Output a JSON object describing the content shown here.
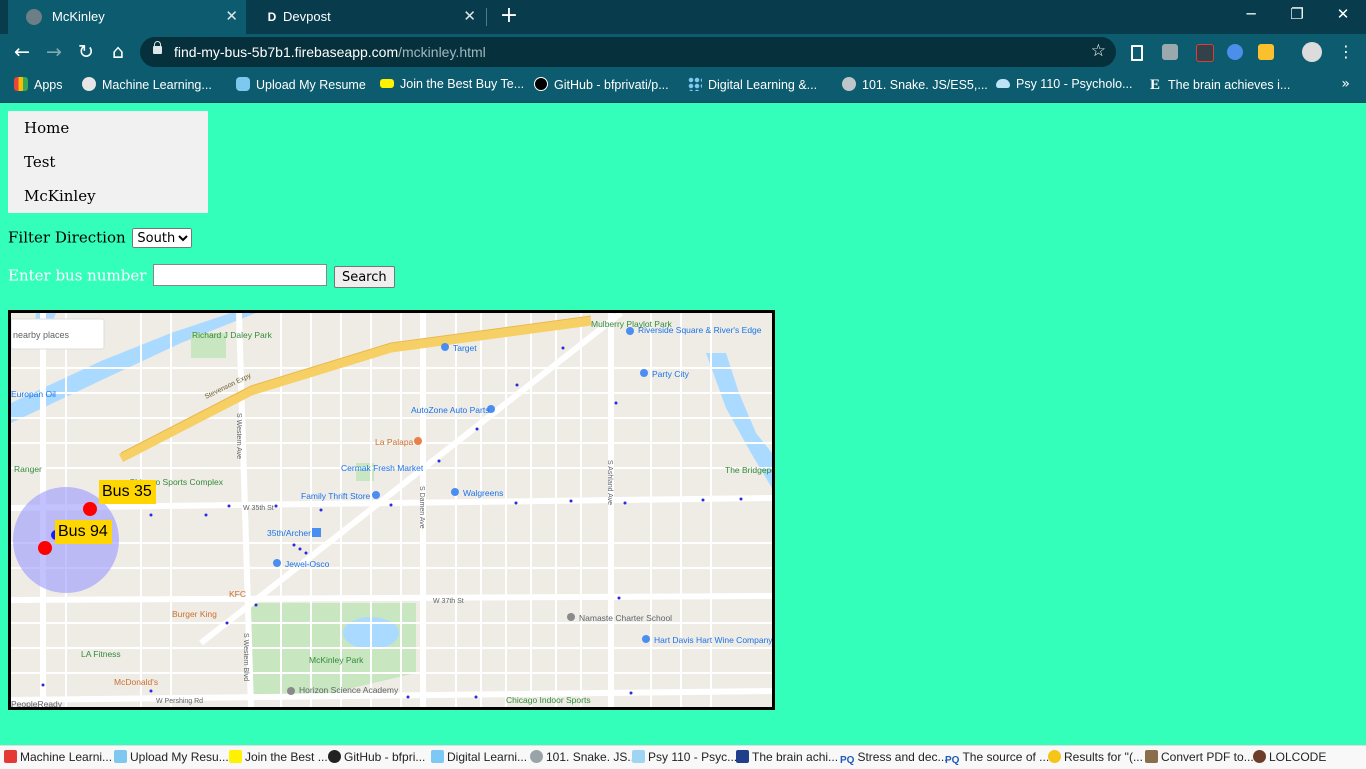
{
  "browser": {
    "tabs": [
      {
        "favicon": "globe-icon",
        "title": "McKinley"
      },
      {
        "favicon": "D",
        "title": "Devpost"
      }
    ],
    "new_tab": "+",
    "window": {
      "minimize": "─",
      "restore": "❐",
      "close": "✕"
    },
    "url_host": "find-my-bus-5b7b1.firebaseapp.com",
    "url_path": "/mckinley.html",
    "bookmarks": [
      {
        "icon": "apps-icon",
        "label": "Apps"
      },
      {
        "icon": "globe-icon",
        "label": "Machine Learning..."
      },
      {
        "icon": "database-icon",
        "label": "Upload My Resume"
      },
      {
        "icon": "bestbuy-icon",
        "label": "Join the Best Buy Te..."
      },
      {
        "icon": "github-icon",
        "label": "GitHub - bfprivati/p..."
      },
      {
        "icon": "dots-icon",
        "label": "Digital Learning &..."
      },
      {
        "icon": "g-icon",
        "label": "101. Snake. JS/ES5,..."
      },
      {
        "icon": "cloud-icon",
        "label": "Psy 110 - Psycholo..."
      },
      {
        "icon": "e-icon",
        "label": "The brain achieves i..."
      }
    ],
    "bookmarks_more": "»"
  },
  "nav": {
    "items": [
      "Home",
      "Test",
      "McKinley"
    ]
  },
  "filter": {
    "label": "Filter Direction",
    "selected": "South"
  },
  "search": {
    "label": "Enter bus number",
    "value": "",
    "button": "Search"
  },
  "map": {
    "buses": [
      {
        "label": "Bus 35"
      },
      {
        "label": "Bus 94"
      }
    ],
    "colors": {
      "road_major": "#f6cf65",
      "park": "#c8e6c0",
      "water": "#aadaff",
      "bus_marker": "#ff0000",
      "label_bg": "#ffd600",
      "radius_fill": "#9a9aff"
    },
    "labels": {
      "nearby": "nearby places",
      "park1": "Richard J Daley Park",
      "target": "Target",
      "riverside": "Riverside Square & River's Edge",
      "mulberry": "Mulberry Playlot Park",
      "partycity": "Party City",
      "autozone": "AutoZone Auto Parts",
      "lapalapa": "La Palapa",
      "cermak": "Cermak Fresh Market",
      "walgreens": "Walgreens",
      "family": "Family Thrift Store",
      "chisports": "Chicago Sports Complex",
      "archer": "35th/Archer",
      "jewel": "Jewel-Osco",
      "kfc": "KFC",
      "burgerking": "Burger King",
      "mckinleypark": "McKinley Park",
      "lafitness": "LA Fitness",
      "mcdonalds": "McDonald's",
      "horizon": "Horizon Science Academy",
      "chiindoor": "Chicago Indoor Sports",
      "namaste": "Namaste Charter School",
      "hartdavis": "Hart Davis Hart Wine Company",
      "bridgeport": "The Bridgeport Art Cent",
      "ranger": "Ranger",
      "europa": "Europan Oil",
      "stevenson": "Stevenson Expy",
      "w35": "W 35th St",
      "w37": "W 37th St",
      "pershing": "W Pershing Rd",
      "western": "S Western Ave",
      "westernblvd": "S Western Blvd",
      "ashland": "S Ashland Ave",
      "damen": "S Damen Ave",
      "peopleready": "PeopleReady"
    }
  },
  "shelf": [
    {
      "icon": "acrobat-icon",
      "label": "Machine Learni..."
    },
    {
      "icon": "database-icon",
      "label": "Upload My Resu..."
    },
    {
      "icon": "bestbuy-icon",
      "label": "Join the Best ..."
    },
    {
      "icon": "github-icon",
      "label": "GitHub - bfpri..."
    },
    {
      "icon": "dots-icon",
      "label": "Digital Learni..."
    },
    {
      "icon": "g-icon",
      "label": "101. Snake. JS..."
    },
    {
      "icon": "cloud-icon",
      "label": "Psy 110 - Psyc..."
    },
    {
      "icon": "e-icon",
      "label": "The brain achi..."
    },
    {
      "icon": "pq-icon",
      "label": "Stress and dec..."
    },
    {
      "icon": "pq-icon",
      "label": "The source of ..."
    },
    {
      "icon": "norton-icon",
      "label": "Results for \"(..."
    },
    {
      "icon": "pdf-icon",
      "label": "Convert PDF to..."
    },
    {
      "icon": "lol-icon",
      "label": "LOLCODE"
    }
  ]
}
